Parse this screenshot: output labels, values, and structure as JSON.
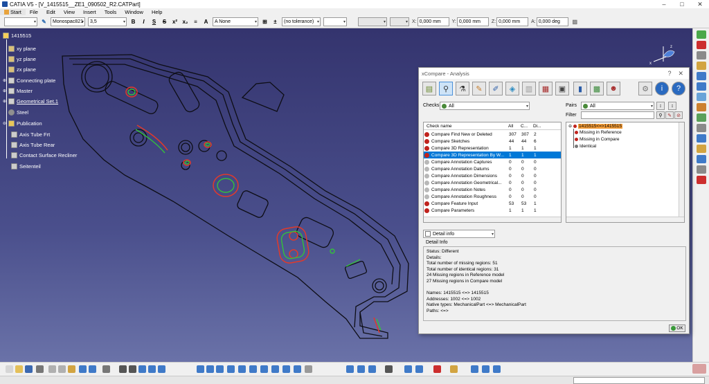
{
  "window": {
    "title": "CATIA V5 - [V_1415515__ZE1_090502_R2.CATPart]",
    "minimize": "–",
    "maximize": "□",
    "close": "✕"
  },
  "menu": [
    "Start",
    "File",
    "Edit",
    "View",
    "Insert",
    "Tools",
    "Window",
    "Help"
  ],
  "toolbar": {
    "font_name": "Monospac821",
    "font_size": "3,5",
    "fill": "A  None",
    "tolerance": "(no tolerance)",
    "x_label": "X:",
    "x_value": "0,000 mm",
    "y_label": "Y:",
    "y_value": "0,000 mm",
    "z_label": "Z:",
    "z_value": "0,000 mm",
    "a_label": "A:",
    "a_value": "0,000 deg"
  },
  "tree": {
    "root": "1415515",
    "items": [
      "xy plane",
      "yz plane",
      "zx plane",
      "Connecting plate",
      "Master",
      "Geometrical Set.1",
      "Steel",
      "Publication",
      "Axis Tube Frt",
      "Axis Tube Rear",
      "Contact Surface Recliner",
      "Seitenteil"
    ]
  },
  "dialog": {
    "title": "xCompare - Analysis",
    "checks_label": "Checks",
    "checks_value": "All",
    "pairs_label": "Pairs",
    "pairs_value": "All",
    "filter_label": "Filter",
    "columns": [
      "Check name",
      "All",
      "C...",
      "Di..."
    ],
    "rows": [
      {
        "name": "Compare Find New or Deleted",
        "all": "307",
        "c": "307",
        "d": "2",
        "status": "red"
      },
      {
        "name": "Compare Sketches",
        "all": "44",
        "c": "44",
        "d": "6",
        "status": "red"
      },
      {
        "name": "Compare 3D Representation",
        "all": "1",
        "c": "1",
        "d": "1",
        "status": "red"
      },
      {
        "name": "Compare 3D Representation By W...",
        "all": "1",
        "c": "1",
        "d": "1",
        "status": "red"
      },
      {
        "name": "Compare Annotation Captures",
        "all": "0",
        "c": "0",
        "d": "0",
        "status": "gray"
      },
      {
        "name": "Compare Annotation Datums",
        "all": "0",
        "c": "0",
        "d": "0",
        "status": "gray"
      },
      {
        "name": "Compare Annotation Dimensions",
        "all": "0",
        "c": "0",
        "d": "0",
        "status": "gray"
      },
      {
        "name": "Compare Annotation Geometrical...",
        "all": "0",
        "c": "0",
        "d": "0",
        "status": "gray"
      },
      {
        "name": "Compare Annotation Notes",
        "all": "0",
        "c": "0",
        "d": "0",
        "status": "gray"
      },
      {
        "name": "Compare Annotation Roughness",
        "all": "0",
        "c": "0",
        "d": "0",
        "status": "gray"
      },
      {
        "name": "Compare Feature Input",
        "all": "53",
        "c": "53",
        "d": "1",
        "status": "red"
      },
      {
        "name": "Compare Parameters",
        "all": "1",
        "c": "1",
        "d": "1",
        "status": "red"
      }
    ],
    "selected_row": 3,
    "pairs_tree": {
      "root": "1415515<=>1415515",
      "children": [
        "Missing in Reference",
        "Missing in Compare",
        "Identical"
      ]
    },
    "detail_select": "Detail info",
    "detail_heading": "Detail Info",
    "detail_lines": [
      "Status: Different",
      "Details:",
      " Total number of missing regions: 51",
      " Total number of identical regions: 31",
      "24 Missing regions in Reference model",
      "27 Missing regions in Compare model",
      "",
      "Names: 1415515 <=> 1415515",
      "Addresses: 1002 <=> 1002",
      "Native types: MechanicalPart <=> MechanicalPart",
      "Paths: <=>"
    ],
    "ok_label": "OK"
  },
  "colors": {
    "viewport_bg": "#3c3f78",
    "selection": "#0078d7",
    "status_red": "#c0231d",
    "status_gray": "#b8b8b8",
    "highlight_orange": "#f39c38"
  }
}
